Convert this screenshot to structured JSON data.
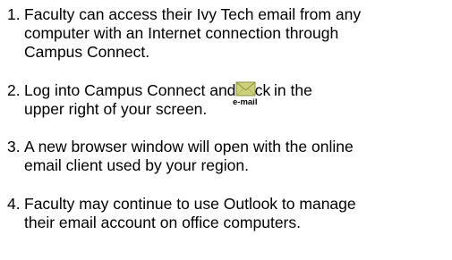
{
  "steps": [
    {
      "number": "1.",
      "lines": [
        "Faculty can access their Ivy Tech email from any",
        "computer with an Internet connection through",
        "Campus Connect."
      ]
    },
    {
      "number": "2.",
      "line1_before_icon": "Log into Campus Connect and click",
      "line1_after_icon": "in the",
      "line2": "upper right of your screen.",
      "icon": "envelope-icon",
      "icon_caption": "e-mail",
      "icon_color": "#c9cf72"
    },
    {
      "number": "3.",
      "lines": [
        "A new browser window will open with the online",
        "email client used by your region."
      ]
    },
    {
      "number": "4.",
      "lines": [
        "Faculty may continue to use Outlook to manage",
        "their email account on office computers."
      ]
    }
  ]
}
